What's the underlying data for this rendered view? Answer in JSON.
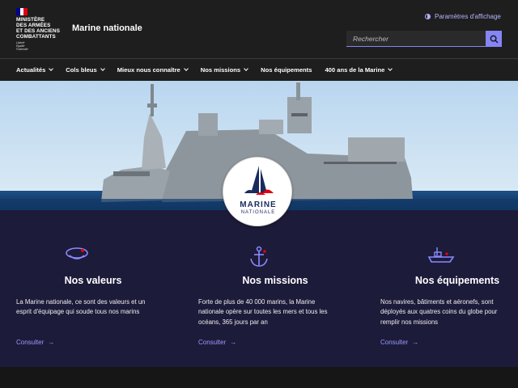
{
  "header": {
    "ministry_lines": [
      "MINISTÈRE",
      "DES ARMÉES",
      "ET DES ANCIENS",
      "COMBATTANTS"
    ],
    "motto_lines": [
      "Liberté",
      "Égalité",
      "Fraternité"
    ],
    "site_title": "Marine nationale",
    "display_settings_label": "Paramètres d'affichage",
    "search_placeholder": "Rechercher",
    "colors": {
      "flag_blue": "#000091",
      "flag_white": "#ffffff",
      "flag_red": "#e1000f",
      "accent": "#8585f6"
    }
  },
  "nav": {
    "items": [
      {
        "label": "Actualités",
        "dropdown": true
      },
      {
        "label": "Cols bleus",
        "dropdown": true
      },
      {
        "label": "Mieux nous connaître",
        "dropdown": true
      },
      {
        "label": "Nos missions",
        "dropdown": true
      },
      {
        "label": "Nos équipements",
        "dropdown": false
      },
      {
        "label": "400 ans de la Marine",
        "dropdown": true
      }
    ]
  },
  "hero": {
    "emblem_line1": "MARINE",
    "emblem_line2": "NATIONALE"
  },
  "cards": [
    {
      "icon": "sailor-cap-icon",
      "title": "Nos valeurs",
      "text": "La Marine nationale, ce sont des valeurs et un esprit d'équipage qui soude tous nos marins",
      "link": "Consulter"
    },
    {
      "icon": "anchor-icon",
      "title": "Nos missions",
      "text": "Forte de plus de 40 000 marins, la Marine nationale opère sur toutes les mers et tous les océans, 365 jours par an",
      "link": "Consulter"
    },
    {
      "icon": "ship-icon",
      "title": "Nos équipements",
      "text": "Nos navires, bâtiments et aéronefs, sont déployés aux quatres coins du globe pour remplir nos missions",
      "link": "Consulter"
    }
  ]
}
